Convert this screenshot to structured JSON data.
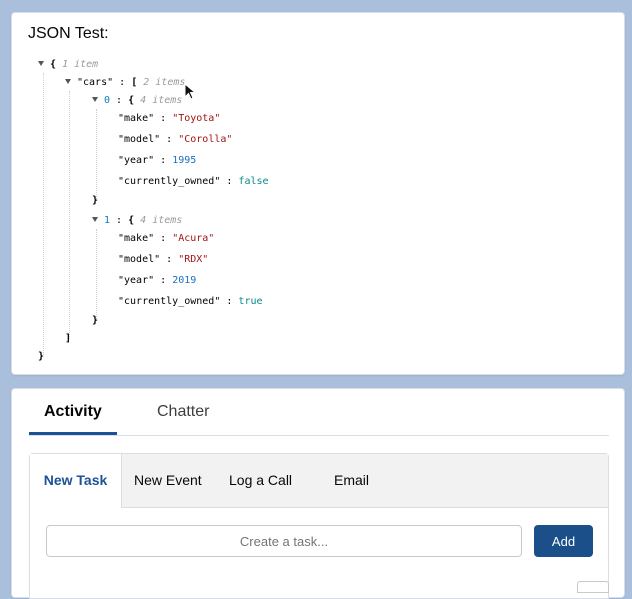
{
  "json_card": {
    "title": "JSON Test:",
    "root_meta": "1 item",
    "cars_key": "\"cars\"",
    "cars_meta": "2 items",
    "items": [
      {
        "index": "0",
        "meta": "4 items",
        "make": "\"Toyota\"",
        "model": "\"Corolla\"",
        "year": "1995",
        "currently_owned": "false"
      },
      {
        "index": "1",
        "meta": "4 items",
        "make": "\"Acura\"",
        "model": "\"RDX\"",
        "year": "2019",
        "currently_owned": "true"
      }
    ],
    "keys": {
      "make": "\"make\"",
      "model": "\"model\"",
      "year": "\"year\"",
      "currently_owned": "\"currently_owned\""
    },
    "colors": {
      "string": "#a31515",
      "number": "#1a6fbf",
      "boolean": "#0a8a8a"
    }
  },
  "activity": {
    "tabs": [
      "Activity",
      "Chatter"
    ],
    "subtabs": [
      "New Task",
      "New Event",
      "Log a Call",
      "Email"
    ],
    "task_placeholder": "Create a task...",
    "add_label": "Add",
    "accent": "#1b5297"
  }
}
